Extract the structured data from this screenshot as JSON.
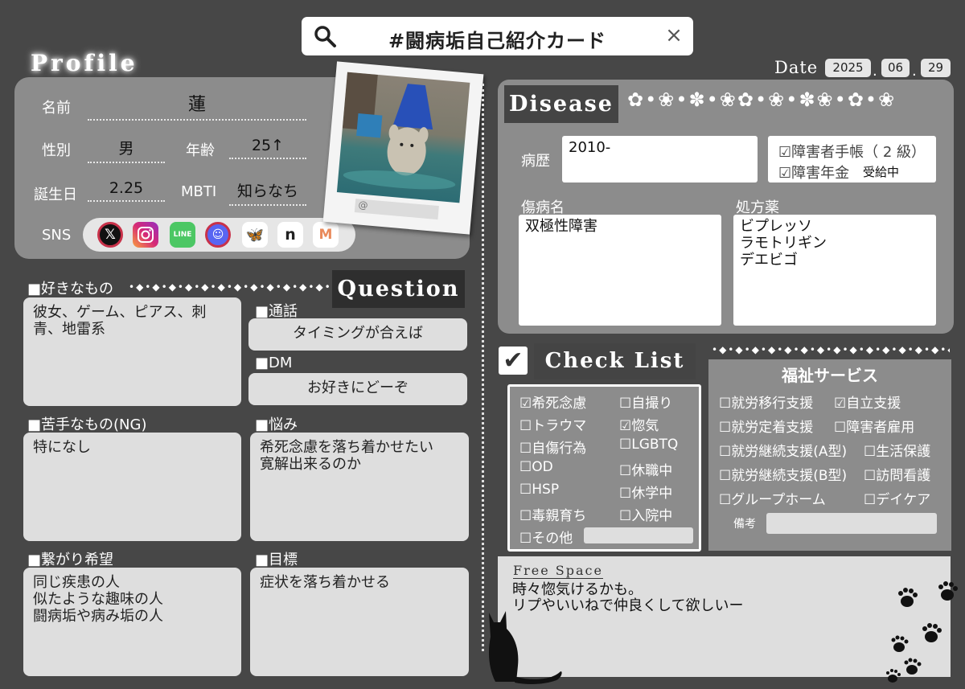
{
  "search": {
    "title": "#闘病垢自己紹介カード",
    "search_icon": "search-icon",
    "close_glyph": "×"
  },
  "profile": {
    "heading": "Profile",
    "name_label": "名前",
    "name": "蓮",
    "gender_label": "性別",
    "gender": "男",
    "age_label": "年齢",
    "age": "25↑",
    "birthday_label": "誕生日",
    "birthday": "2.25",
    "mbti_label": "MBTI",
    "mbti": "知らなち",
    "sns_label": "SNS",
    "sns_icons": [
      "x-icon",
      "instagram-icon",
      "line-icon",
      "discord-icon",
      "bluesky-icon",
      "note-icon",
      "misskey-icon"
    ],
    "photo_handle": "@"
  },
  "date": {
    "label": "Date",
    "year": "2025",
    "month": "06",
    "day": "29"
  },
  "likes": {
    "title": "■好きなもの",
    "text": "彼女、ゲーム、ピアス、刺青、地雷系"
  },
  "dislikes": {
    "title": "■苦手なもの(NG)",
    "text": "特になし"
  },
  "connect": {
    "title": "■繋がり希望",
    "text": "同じ疾患の人\n似たような趣味の人\n闘病垢や病み垢の人"
  },
  "question": {
    "heading": "Question",
    "call_title": "■通話",
    "call": "タイミングが合えば",
    "dm_title": "■DM",
    "dm": "お好きにどーぞ",
    "worry_title": "■悩み",
    "worry": "希死念慮を落ち着かせたい\n寛解出来るのか",
    "goal_title": "■目標",
    "goal": "症状を落ち着かせる"
  },
  "disease": {
    "heading": "Disease",
    "history_label": "病歴",
    "history": "2010-",
    "handbook": "☑障害者手帳（ 2 級）",
    "pension": "☑障害年金",
    "pension_status": "受給中",
    "diagnosis_label": "傷病名",
    "diagnosis": "双極性障害",
    "meds_label": "処方薬",
    "meds": "ビプレッソ\nラモトリギン\nデエビゴ"
  },
  "checklist": {
    "heading": "Check List",
    "check_glyph": "✔",
    "left": [
      "☑希死念慮",
      "☐トラウマ",
      "☐自傷行為",
      "☐OD",
      "☐HSP",
      "☐毒親育ち",
      "☐その他"
    ],
    "right": [
      "☐自撮り",
      "☑惚気",
      "☐LGBTQ",
      "☐休職中",
      "☐休学中",
      "☐入院中"
    ]
  },
  "welfare": {
    "title": "福祉サービス",
    "left": [
      "☐就労移行支援",
      "☐就労定着支援",
      "☐就労継続支援(A型)",
      "☐就労継続支援(B型)",
      "☐グループホーム"
    ],
    "right": [
      "☑自立支援",
      "☐障害者雇用",
      "☐生活保護",
      "☐訪問看護",
      "☐デイケア"
    ],
    "notes_label": "備考"
  },
  "free_space": {
    "title": "Free Space",
    "text": "時々惚気けるかも。\nリプやいいねで仲良くして欲しいー"
  },
  "decor": {
    "flowers": "✿•❀•✽•❀✿•❀•✽❀•✿•❀",
    "dots": "•◆•◆•◆•◆•◆•◆•◆•◆•◆•◆•◆•◆•◆•◆•◆•"
  }
}
